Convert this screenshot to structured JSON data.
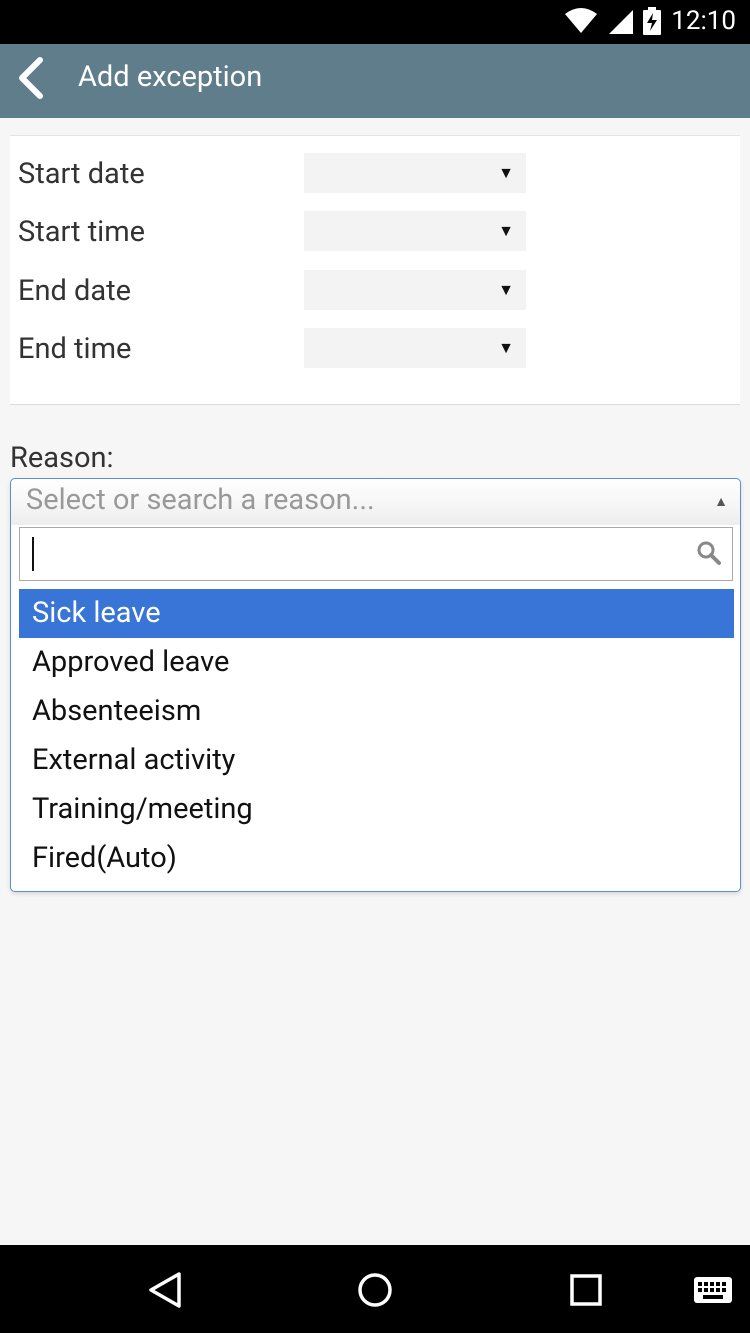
{
  "status_bar": {
    "time": "12:10"
  },
  "app_bar": {
    "title": "Add exception"
  },
  "form": {
    "fields": [
      {
        "label": "Start date",
        "value": ""
      },
      {
        "label": "Start time",
        "value": ""
      },
      {
        "label": "End date",
        "value": ""
      },
      {
        "label": "End time",
        "value": ""
      }
    ]
  },
  "reason": {
    "label": "Reason:",
    "placeholder": "Select or search a reason...",
    "search_value": "",
    "options": [
      "Sick leave",
      "Approved leave",
      "Absenteeism",
      "External activity",
      "Training/meeting",
      "Fired(Auto)"
    ],
    "selected": "Sick leave"
  },
  "colors": {
    "app_bar": "#607d8b",
    "highlight": "#3875d7",
    "dropdown_border": "#5a8fd6"
  },
  "icons": [
    "wifi-icon",
    "signal-icon",
    "battery-charging-icon",
    "back-arrow-icon",
    "search-icon",
    "nav-back-icon",
    "home-icon",
    "recents-icon",
    "keyboard-icon"
  ]
}
